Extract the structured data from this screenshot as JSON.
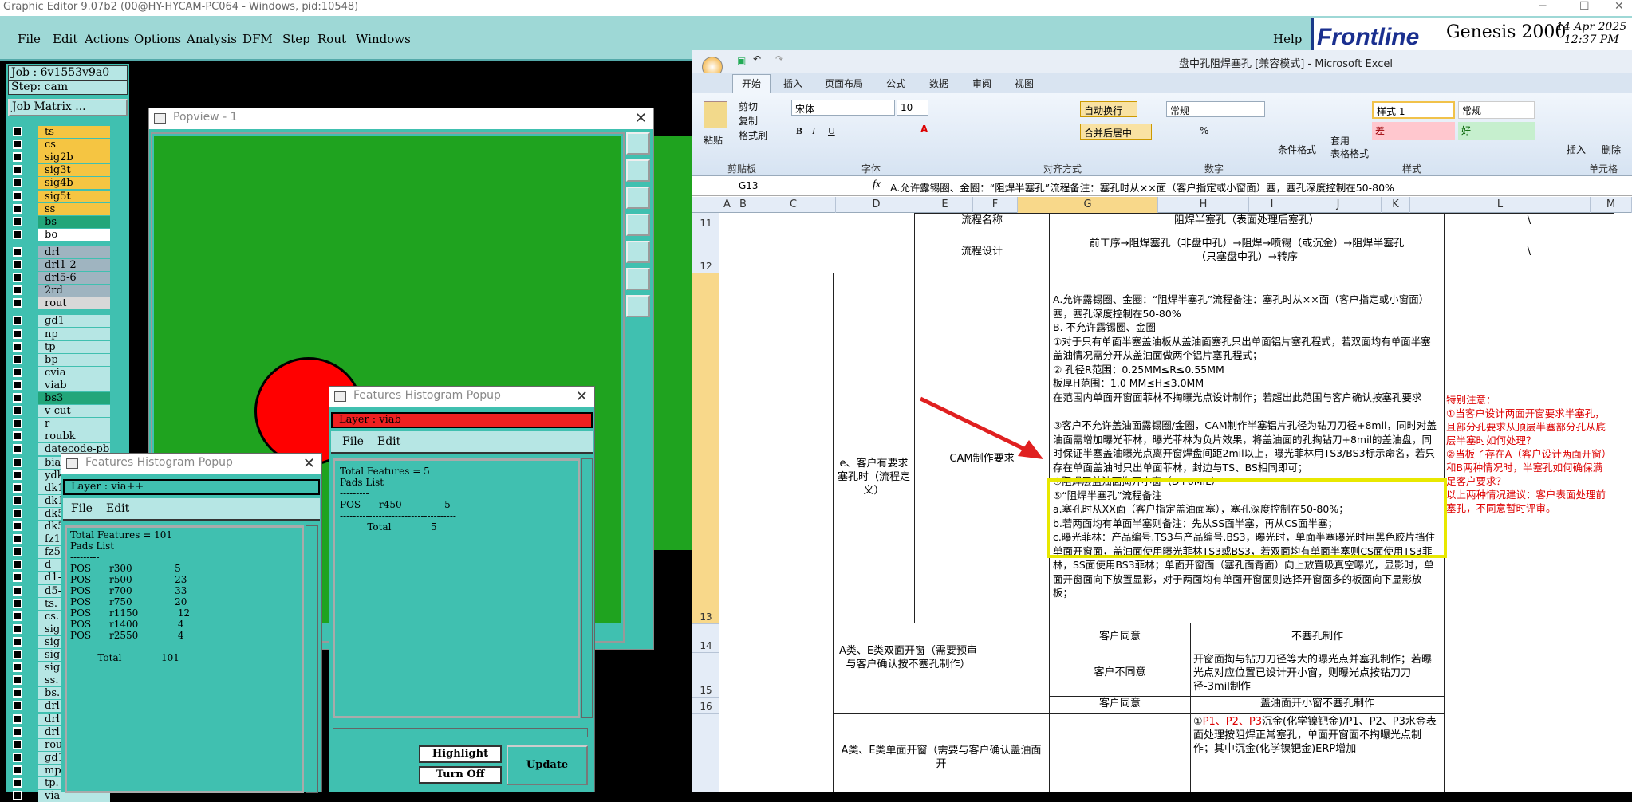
{
  "genesis": {
    "title": "Graphic Editor 9.07b2 (00@HY-HYCAM-PC064 - Windows, pid:10548)",
    "menu": [
      "File",
      "Edit",
      "Actions",
      "Options",
      "Analysis",
      "DFM",
      "Step",
      "Rout",
      "Windows"
    ],
    "help": "Help",
    "brand": "Frontline",
    "product": "Genesis 2000",
    "date": "14 Apr 2025",
    "time": "12:37 PM",
    "job": "Job : 6v1553v9a0",
    "step": "Step: cam",
    "job_matrix": "Job Matrix ...",
    "layers": [
      {
        "name": "ts",
        "color": "#f5c542"
      },
      {
        "name": "cs",
        "color": "#f5c542"
      },
      {
        "name": "sig2b",
        "color": "#f5c542"
      },
      {
        "name": "sig3t",
        "color": "#f5c542"
      },
      {
        "name": "sig4b",
        "color": "#f5c542"
      },
      {
        "name": "sig5t",
        "color": "#f5c542"
      },
      {
        "name": "ss",
        "color": "#f5c542"
      },
      {
        "name": "bs",
        "color": "#22a67a"
      },
      {
        "name": "bo",
        "color": "#ffffff"
      },
      {
        "name": "drl",
        "color": "#9fb4c0"
      },
      {
        "name": "drl1-2",
        "color": "#9fb4c0"
      },
      {
        "name": "drl5-6",
        "color": "#9fb4c0"
      },
      {
        "name": "2rd",
        "color": "#9fb4c0"
      },
      {
        "name": "rout",
        "color": "#d8d8d8"
      },
      {
        "name": "gd1",
        "color": "#b6e6e4"
      },
      {
        "name": "np",
        "color": "#b6e6e4"
      },
      {
        "name": "tp",
        "color": "#b6e6e4"
      },
      {
        "name": "bp",
        "color": "#b6e6e4"
      },
      {
        "name": "cvia",
        "color": "#b6e6e4"
      },
      {
        "name": "viab",
        "color": "#b6e6e4"
      },
      {
        "name": "bs3",
        "color": "#22a67a"
      },
      {
        "name": "v-cut",
        "color": "#b6e6e4"
      },
      {
        "name": "r",
        "color": "#b6e6e4"
      },
      {
        "name": "roubk",
        "color": "#b6e6e4"
      },
      {
        "name": "datecode-pb",
        "color": "#b6e6e4"
      },
      {
        "name": "bia",
        "color": "#b6e6e4"
      },
      {
        "name": "ydk",
        "color": "#b6e6e4"
      },
      {
        "name": "dk1",
        "color": "#b6e6e4"
      },
      {
        "name": "dk1",
        "color": "#b6e6e4"
      },
      {
        "name": "dk5",
        "color": "#b6e6e4"
      },
      {
        "name": "dk5",
        "color": "#b6e6e4"
      },
      {
        "name": "fz1",
        "color": "#b6e6e4"
      },
      {
        "name": "fz5",
        "color": "#b6e6e4"
      },
      {
        "name": "d",
        "color": "#b6e6e4"
      },
      {
        "name": "d1-",
        "color": "#b6e6e4"
      },
      {
        "name": "d5-",
        "color": "#b6e6e4"
      },
      {
        "name": "ts.",
        "color": "#b6e6e4"
      },
      {
        "name": "cs.",
        "color": "#b6e6e4"
      },
      {
        "name": "sig",
        "color": "#b6e6e4"
      },
      {
        "name": "sig",
        "color": "#b6e6e4"
      },
      {
        "name": "sig",
        "color": "#b6e6e4"
      },
      {
        "name": "sig",
        "color": "#b6e6e4"
      },
      {
        "name": "ss.",
        "color": "#b6e6e4"
      },
      {
        "name": "bs.",
        "color": "#b6e6e4"
      },
      {
        "name": "drl",
        "color": "#b6e6e4"
      },
      {
        "name": "drl",
        "color": "#b6e6e4"
      },
      {
        "name": "drl",
        "color": "#b6e6e4"
      },
      {
        "name": "rou",
        "color": "#b6e6e4"
      },
      {
        "name": "gd1",
        "color": "#b6e6e4"
      },
      {
        "name": "mp.",
        "color": "#b6e6e4"
      },
      {
        "name": "tp.",
        "color": "#b6e6e4"
      },
      {
        "name": "via",
        "color": "#b6e6e4"
      }
    ],
    "popview_title": "Popview - 1",
    "fh1": {
      "title": "Features Histogram Popup",
      "layer": "Layer :  via++",
      "file": "File",
      "edit": "Edit",
      "lines": [
        "Total Features = 101",
        "",
        "Pads List",
        "---------",
        "",
        "POS      r300              5",
        "POS      r500              23",
        "POS      r700              33",
        "POS      r750              20",
        "POS      r1150             12",
        "POS      r1400             4",
        "POS      r2550             4",
        "-------------------------------------------",
        "         Total             101"
      ]
    },
    "fh2": {
      "title": "Features Histogram Popup",
      "layer": "Layer :  viab",
      "file": "File",
      "edit": "Edit",
      "lines": [
        "Total Features = 5",
        "",
        "Pads List",
        "---------",
        "",
        "POS      r450              5",
        "------------------------------------",
        "         Total             5"
      ],
      "highlight": "Highlight",
      "turnoff": "Turn Off",
      "update": "Update"
    }
  },
  "excel": {
    "title": "盘中孔阻焊塞孔  [兼容模式] - Microsoft Excel",
    "tabs": [
      "开始",
      "插入",
      "页面布局",
      "公式",
      "数据",
      "审阅",
      "视图"
    ],
    "ribbon": {
      "paste": "粘贴",
      "cut": "剪切",
      "copy": "复制",
      "format_painter": "格式刷",
      "clipboard": "剪贴板",
      "font": "宋体",
      "size": "10",
      "font_group": "字体",
      "wrap": "自动换行",
      "merge": "合并后居中",
      "align_group": "对齐方式",
      "number_fmt": "常规",
      "percent": "%",
      "number_group": "数字",
      "cond_fmt": "条件格式",
      "table_fmt": "套用\n表格格式",
      "style1": "样式 1",
      "normal": "常规",
      "bad": "差",
      "good": "好",
      "styles_group": "样式",
      "insert": "插入",
      "delete": "删除",
      "cells_group": "单元格"
    },
    "namebox": "G13",
    "formula": "A.允许露锡圈、金圈：“阻焊半塞孔”流程备注：塞孔时从××面（客户指定或小窗面）塞，塞孔深度控制在50-80%",
    "columns": [
      "A",
      "B",
      "C",
      "D",
      "E",
      "F",
      "G",
      "H",
      "I",
      "J",
      "K",
      "L",
      "M"
    ],
    "rows": [
      "11",
      "12",
      "13",
      "14",
      "15",
      "16"
    ],
    "r11": {
      "label": "流程名称",
      "value": "阻焊半塞孔（表面处理后塞孔）",
      "l": "\\"
    },
    "r12": {
      "label": "流程设计",
      "value": "前工序→阻焊塞孔（非盘中孔）→阻焊→喷锡（或沉金）→阻焊半塞孔\n（只塞盘中孔）→转序",
      "l": "\\"
    },
    "r13": {
      "d": "e、客户有要求塞孔时（流程定义）",
      "e": "CAM制作要求",
      "g_top": "A.允许露锡圈、金圈：“阻焊半塞孔”流程备注：塞孔时从××面（客户指定或小窗面）塞，塞孔深度控制在50-80%\nB. 不允许露锡圈、金圈\n①对于只有单面半塞盖油板从盖油面塞孔只出单面铝片塞孔程式，若双面均有单面半塞盖油情况需分开从盖油面做两个铝片塞孔程式；\n② 孔径R范围：0.25MM≤R≤0.55MM\n    板厚H范围：1.0 MM≤H≤3.0MM\n在范围内单面开窗面菲林不掏曝光点设计制作；若超出此范围与客户确认按塞孔要求",
      "g_hl": "③客户不允许盖油面露锡圈/金圈，CAM制作半塞铝片孔径为钻刀刀径+8mil，同时对盖油面需增加曝光菲林，曝光菲林为负片效果，将盖油面的孔掏钻刀+8mil的盖油盘，同时保证半塞盖油曝光点离开窗焊盘间距2mil以上，曝光菲林用TS3/BS3标示命名，若只存在单面盖油时只出单面菲林，封边与TS、BS相同即可；",
      "g_bottom": "④阻焊层盖油面掏开小窗（D+6MIL）\n⑤“阻焊半塞孔”流程备注\na.塞孔时从XX面（客户指定盖油面塞），塞孔深度控制在50-80%；\nb.若两面均有单面半塞则备注：先从SS面半塞，再从CS面半塞；\nc.曝光菲林：产品编号.TS3与产品编号.BS3，曝光时，单面半塞曝光时用黑色胶片挡住单面开窗面，盖油面使用曝光菲林TS3或BS3，若双面均有单面半塞则CS面使用TS3菲林，SS面使用BS3菲林；单面开窗面（塞孔面背面）向上放置吸真空曝光，显影时，单面开窗面向下放置显影，对于两面均有单面开窗面则选择开窗面多的板面向下显影放板；",
      "l": "特别注意：\n①当客户设计两面开窗要求半塞孔，且部分孔要求从顶层半塞部分孔从底层半塞时如何处理？\n②当板子存在A（客户设计两面开窗）和B两种情况时，半塞孔如何确保满足客户要求？\n以上两种情况建议：客户表面处理前塞孔，不同意暂时评审。"
    },
    "r14": {
      "d": "A类、E类双面开窗（需要预审与客户确认按不塞孔制作）",
      "g": "客户同意",
      "i": "不塞孔制作"
    },
    "r15": {
      "g": "客户不同意",
      "i": "开窗面掏与钻刀刀径等大的曝光点并塞孔制作；若曝光点对应位置已设计开小窗，则曝光点按钻刀刀径-3mil制作"
    },
    "r16": {
      "g": "客户同意",
      "i": "盖油面开小窗不塞孔制作"
    },
    "r17": {
      "d": "A类、E类单面开窗（需要与客户确认盖油面开",
      "i1": "①",
      "i_red": "P1、P2、P3",
      "i2": "沉金(化学镍钯金)/P1、P2、P3水金表面处理按阻焊正常塞孔，单面开窗面不掏曝光点制作；其中沉金(化学镍钯金)ERP增加"
    }
  },
  "colors": {
    "genesis_bg": "#40c0b0",
    "menu_bg": "#9ed8d6",
    "highlight_box": "#e8e800",
    "arrow": "#e02020",
    "pad": "#ff0000",
    "board": "#1fa31f"
  }
}
